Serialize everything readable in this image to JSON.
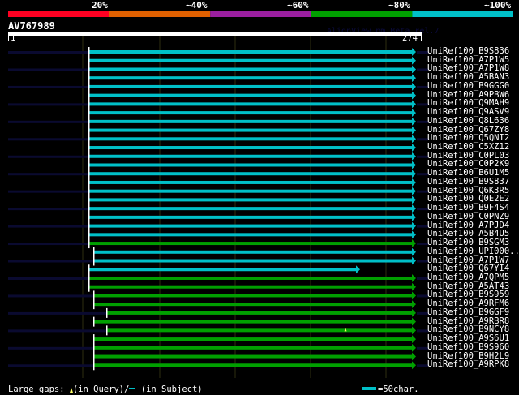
{
  "colors": {
    "cyan": "#00c0c8",
    "green": "#00a000",
    "navy": "#0a0a30",
    "grid": "#2e2e10"
  },
  "identity_bar": {
    "labels": [
      "20%",
      "~40%",
      "~60%",
      "~80%",
      "~100%"
    ],
    "colors": [
      "#ff0022",
      "#e06000",
      "#9b1fa0",
      "#00a000",
      "#00c0c8"
    ]
  },
  "query": {
    "name": "AV767989",
    "version": "AlignView.pm Beta rel.7",
    "start": "1",
    "end": "274",
    "length": 274
  },
  "hits": [
    {
      "name": "UniRef100_B9S836",
      "color": "cyan",
      "start": 55,
      "end": 274
    },
    {
      "name": "UniRef100_A7P1W5",
      "color": "cyan",
      "start": 55,
      "end": 274
    },
    {
      "name": "UniRef100_A7P1W8",
      "color": "cyan",
      "start": 55,
      "end": 274
    },
    {
      "name": "UniRef100_A5BAN3",
      "color": "cyan",
      "start": 55,
      "end": 274
    },
    {
      "name": "UniRef100_B9GGG0",
      "color": "cyan",
      "start": 55,
      "end": 274
    },
    {
      "name": "UniRef100_A9PBW6",
      "color": "cyan",
      "start": 55,
      "end": 274
    },
    {
      "name": "UniRef100_Q9MAH9",
      "color": "cyan",
      "start": 55,
      "end": 274
    },
    {
      "name": "UniRef100_Q9ASV9",
      "color": "cyan",
      "start": 55,
      "end": 274
    },
    {
      "name": "UniRef100_Q8L636",
      "color": "cyan",
      "start": 55,
      "end": 274
    },
    {
      "name": "UniRef100_Q67ZY8",
      "color": "cyan",
      "start": 55,
      "end": 274
    },
    {
      "name": "UniRef100_Q5QNI2",
      "color": "cyan",
      "start": 55,
      "end": 274
    },
    {
      "name": "UniRef100_C5XZ12",
      "color": "cyan",
      "start": 55,
      "end": 274
    },
    {
      "name": "UniRef100_C0PL03",
      "color": "cyan",
      "start": 55,
      "end": 274
    },
    {
      "name": "UniRef100_C0P2K9",
      "color": "cyan",
      "start": 55,
      "end": 274
    },
    {
      "name": "UniRef100_B6U1M5",
      "color": "cyan",
      "start": 55,
      "end": 274
    },
    {
      "name": "UniRef100_B9S837",
      "color": "cyan",
      "start": 55,
      "end": 274
    },
    {
      "name": "UniRef100_Q6K3R5",
      "color": "cyan",
      "start": 55,
      "end": 274
    },
    {
      "name": "UniRef100_Q0E2E2",
      "color": "cyan",
      "start": 55,
      "end": 274
    },
    {
      "name": "UniRef100_B9F4S4",
      "color": "cyan",
      "start": 55,
      "end": 274
    },
    {
      "name": "UniRef100_C0PNZ9",
      "color": "cyan",
      "start": 55,
      "end": 274
    },
    {
      "name": "UniRef100_A7PJD4",
      "color": "cyan",
      "start": 55,
      "end": 274
    },
    {
      "name": "UniRef100_A5B4U5",
      "color": "cyan",
      "start": 55,
      "end": 274
    },
    {
      "name": "UniRef100_B9SGM3",
      "color": "green",
      "start": 55,
      "end": 274
    },
    {
      "name": "UniRef100_UPI000..",
      "color": "cyan",
      "start": 58,
      "end": 274
    },
    {
      "name": "UniRef100_A7P1W7",
      "color": "cyan",
      "start": 58,
      "end": 274
    },
    {
      "name": "UniRef100_Q67YI4",
      "color": "cyan",
      "start": 55,
      "end": 236
    },
    {
      "name": "UniRef100_A7QPM5",
      "color": "green",
      "start": 55,
      "end": 274
    },
    {
      "name": "UniRef100_A5AT43",
      "color": "green",
      "start": 55,
      "end": 274
    },
    {
      "name": "UniRef100_B9S959",
      "color": "green",
      "start": 58,
      "end": 274
    },
    {
      "name": "UniRef100_A9RFM6",
      "color": "green",
      "start": 58,
      "end": 274
    },
    {
      "name": "UniRef100_B9GGF9",
      "color": "green",
      "start": 67,
      "end": 274
    },
    {
      "name": "UniRef100_A9RBR8",
      "color": "green",
      "start": 58,
      "end": 274
    },
    {
      "name": "UniRef100_B9NCY8",
      "color": "green",
      "start": 67,
      "end": 274,
      "query_gap_at": 228
    },
    {
      "name": "UniRef100_A9S6U1",
      "color": "green",
      "start": 58,
      "end": 274
    },
    {
      "name": "UniRef100_B9S960",
      "color": "green",
      "start": 58,
      "end": 274
    },
    {
      "name": "UniRef100_B9H2L9",
      "color": "green",
      "start": 58,
      "end": 274
    },
    {
      "name": "UniRef100_A9RPK8",
      "color": "green",
      "start": 58,
      "end": 274
    }
  ],
  "legend": {
    "prefix": "Large gaps:",
    "query": "(in Query)/",
    "subject": "(in Subject)",
    "scale": "=50char."
  }
}
